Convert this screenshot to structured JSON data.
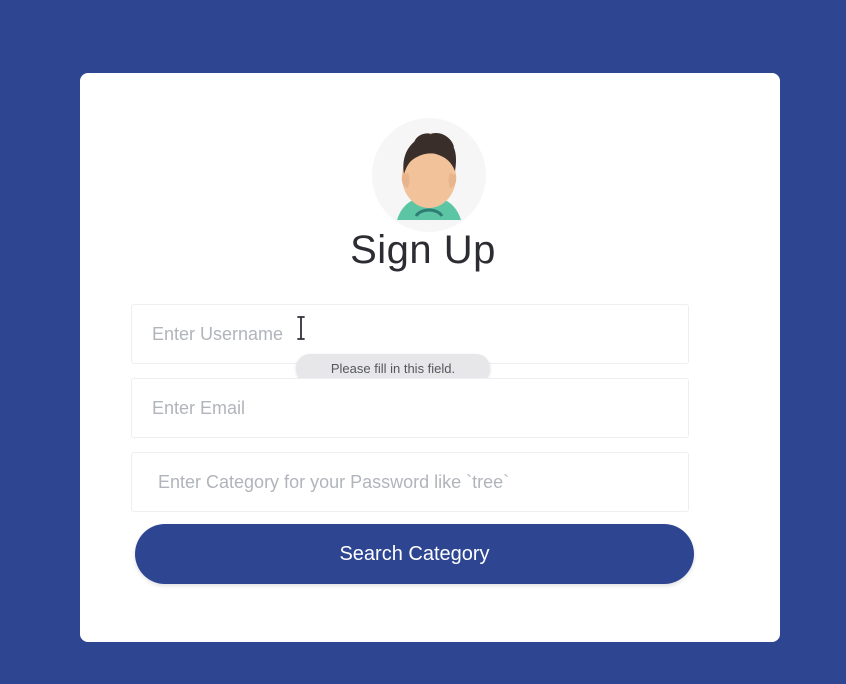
{
  "page": {
    "title": "Sign Up",
    "avatar": "user-avatar-icon",
    "background_color": "#2e4592",
    "accent_color": "#2e4592"
  },
  "form": {
    "username": {
      "placeholder": "Enter Username",
      "value": ""
    },
    "email": {
      "placeholder": "Enter Email",
      "value": ""
    },
    "category": {
      "placeholder": "Enter Category for your Password like `tree`",
      "value": ""
    },
    "validation_tooltip": "Please fill in this field.",
    "submit_label": "Search Category"
  }
}
